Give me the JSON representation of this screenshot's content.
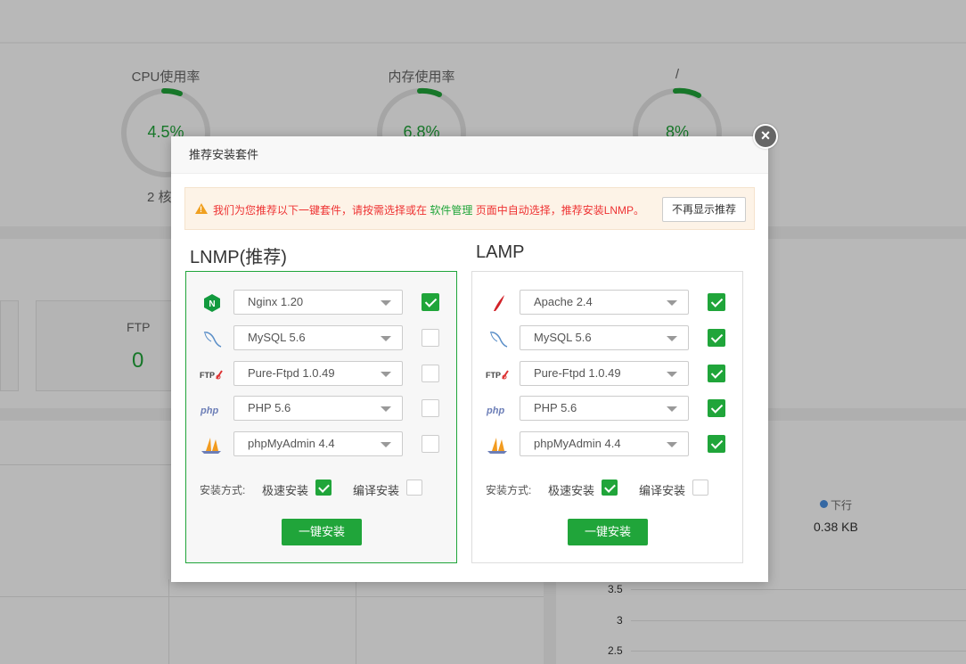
{
  "dashboard": {
    "gauges": [
      {
        "title": "CPU使用率",
        "value": "4.5%",
        "sub": "2 核"
      },
      {
        "title": "内存使用率",
        "value": "6.8%"
      },
      {
        "title": "/",
        "value": "8%"
      }
    ],
    "ftp": {
      "label": "FTP",
      "count": "0"
    },
    "traffic": {
      "legend": "下行",
      "value": "0.38 KB"
    },
    "yticks": [
      "3.5",
      "3",
      "2.5"
    ]
  },
  "modal": {
    "title": "推荐安装套件",
    "close_label": "×",
    "notice": {
      "text_before": "我们为您推荐以下一键套件，请按需选择或在 ",
      "link": "软件管理",
      "text_after": " 页面中自动选择，推荐安装LNMP。",
      "hide_button": "不再显示推荐"
    },
    "suites": [
      {
        "title": "LNMP(推荐)",
        "items": [
          {
            "icon": "nginx-icon",
            "value": "Nginx 1.20",
            "checked": true
          },
          {
            "icon": "mysql-icon",
            "value": "MySQL 5.6",
            "checked": false
          },
          {
            "icon": "ftp-icon",
            "value": "Pure-Ftpd 1.0.49",
            "checked": false
          },
          {
            "icon": "php-icon",
            "value": "PHP 5.6",
            "checked": false
          },
          {
            "icon": "phpmyadmin-icon",
            "value": "phpMyAdmin 4.4",
            "checked": false
          }
        ],
        "method_label": "安装方式:",
        "fast_label": "极速安装",
        "fast_checked": true,
        "compile_label": "编译安装",
        "compile_checked": false,
        "install_button": "一键安装"
      },
      {
        "title": "LAMP",
        "items": [
          {
            "icon": "apache-icon",
            "value": "Apache 2.4",
            "checked": true
          },
          {
            "icon": "mysql-icon",
            "value": "MySQL 5.6",
            "checked": true
          },
          {
            "icon": "ftp-icon",
            "value": "Pure-Ftpd 1.0.49",
            "checked": true
          },
          {
            "icon": "php-icon",
            "value": "PHP 5.6",
            "checked": true
          },
          {
            "icon": "phpmyadmin-icon",
            "value": "phpMyAdmin 4.4",
            "checked": true
          }
        ],
        "method_label": "安装方式:",
        "fast_label": "极速安装",
        "fast_checked": true,
        "compile_label": "编译安装",
        "compile_checked": false,
        "install_button": "一键安装"
      }
    ]
  },
  "colors": {
    "accent": "#20a53a",
    "warning": "#e33333",
    "notice_bg": "#fdf3e7"
  }
}
